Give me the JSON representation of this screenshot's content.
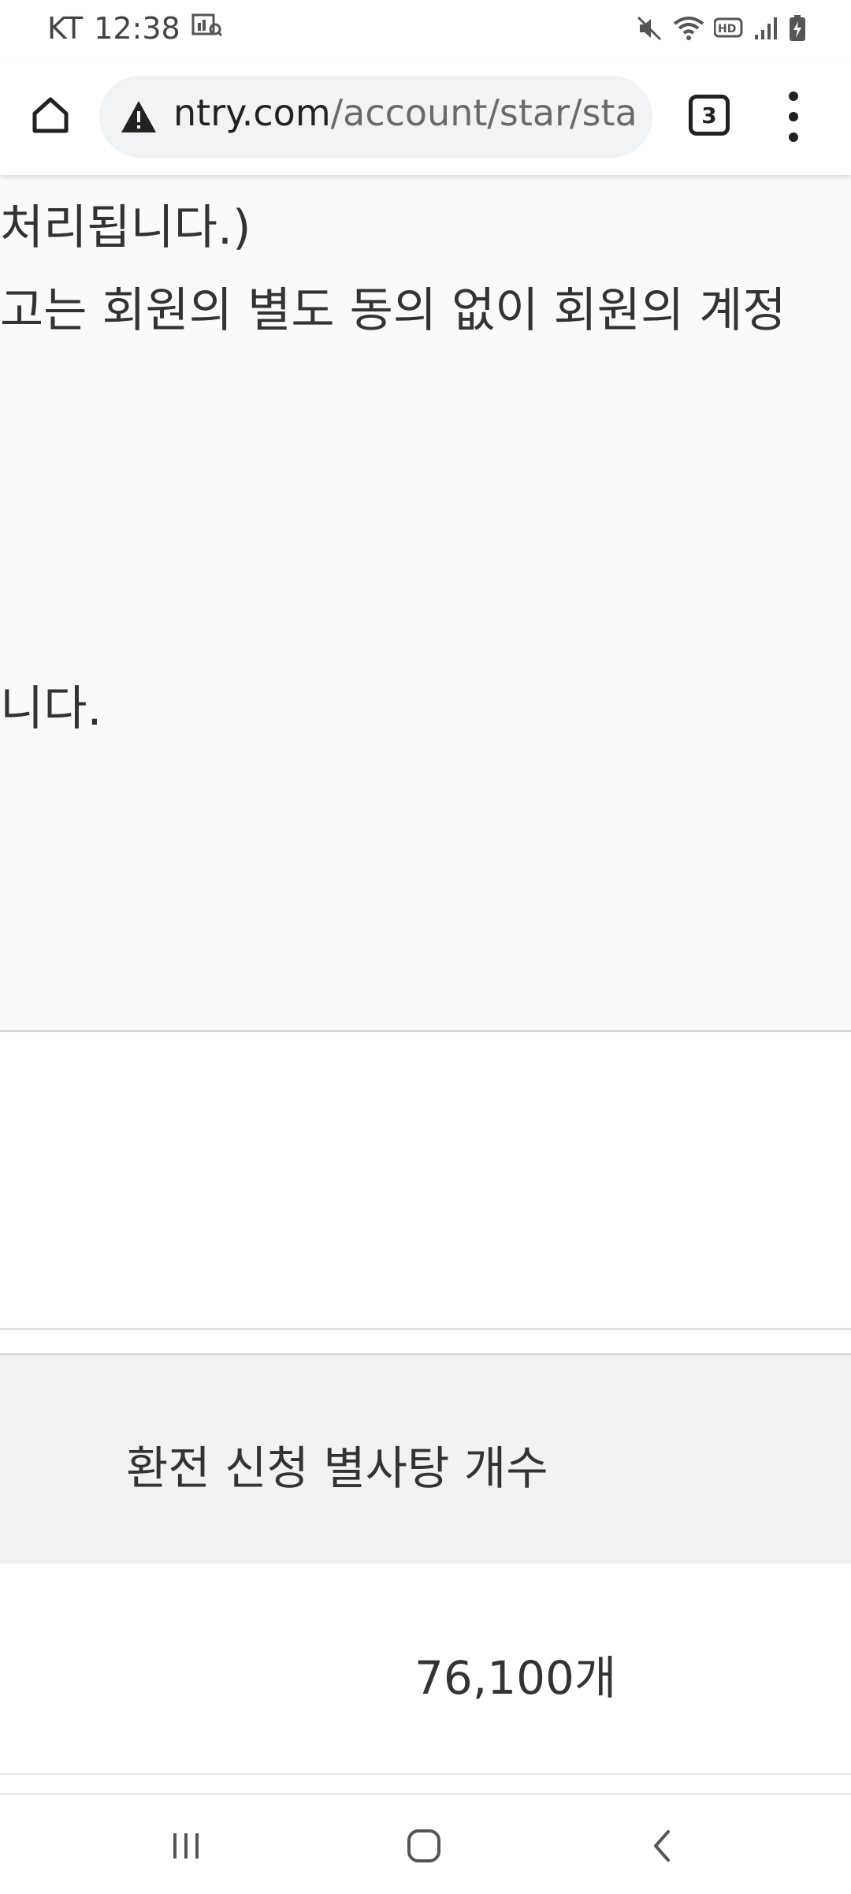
{
  "status_bar": {
    "carrier": "KT",
    "time": "12:38",
    "icons": [
      "gallery-icon",
      "mute-icon",
      "wifi-icon",
      "hd-icon",
      "signal-icon",
      "battery-charging-icon"
    ]
  },
  "browser": {
    "url_host": "ntry.com",
    "url_path": "/account/star/star_",
    "tab_count": "3",
    "icons": [
      "home-icon",
      "warning-icon",
      "tabs-icon",
      "more-vert-icon"
    ]
  },
  "content": {
    "lines": [
      "처리됩니다.)",
      "고는 회원의 별도 동의 없이 회원의 계정",
      "니다."
    ]
  },
  "table": {
    "header": "환전 신청 별사탕 개수",
    "value": "76,100개"
  },
  "nav_bar": {
    "icons": [
      "recent-apps-icon",
      "home-circle-icon",
      "back-icon"
    ]
  }
}
